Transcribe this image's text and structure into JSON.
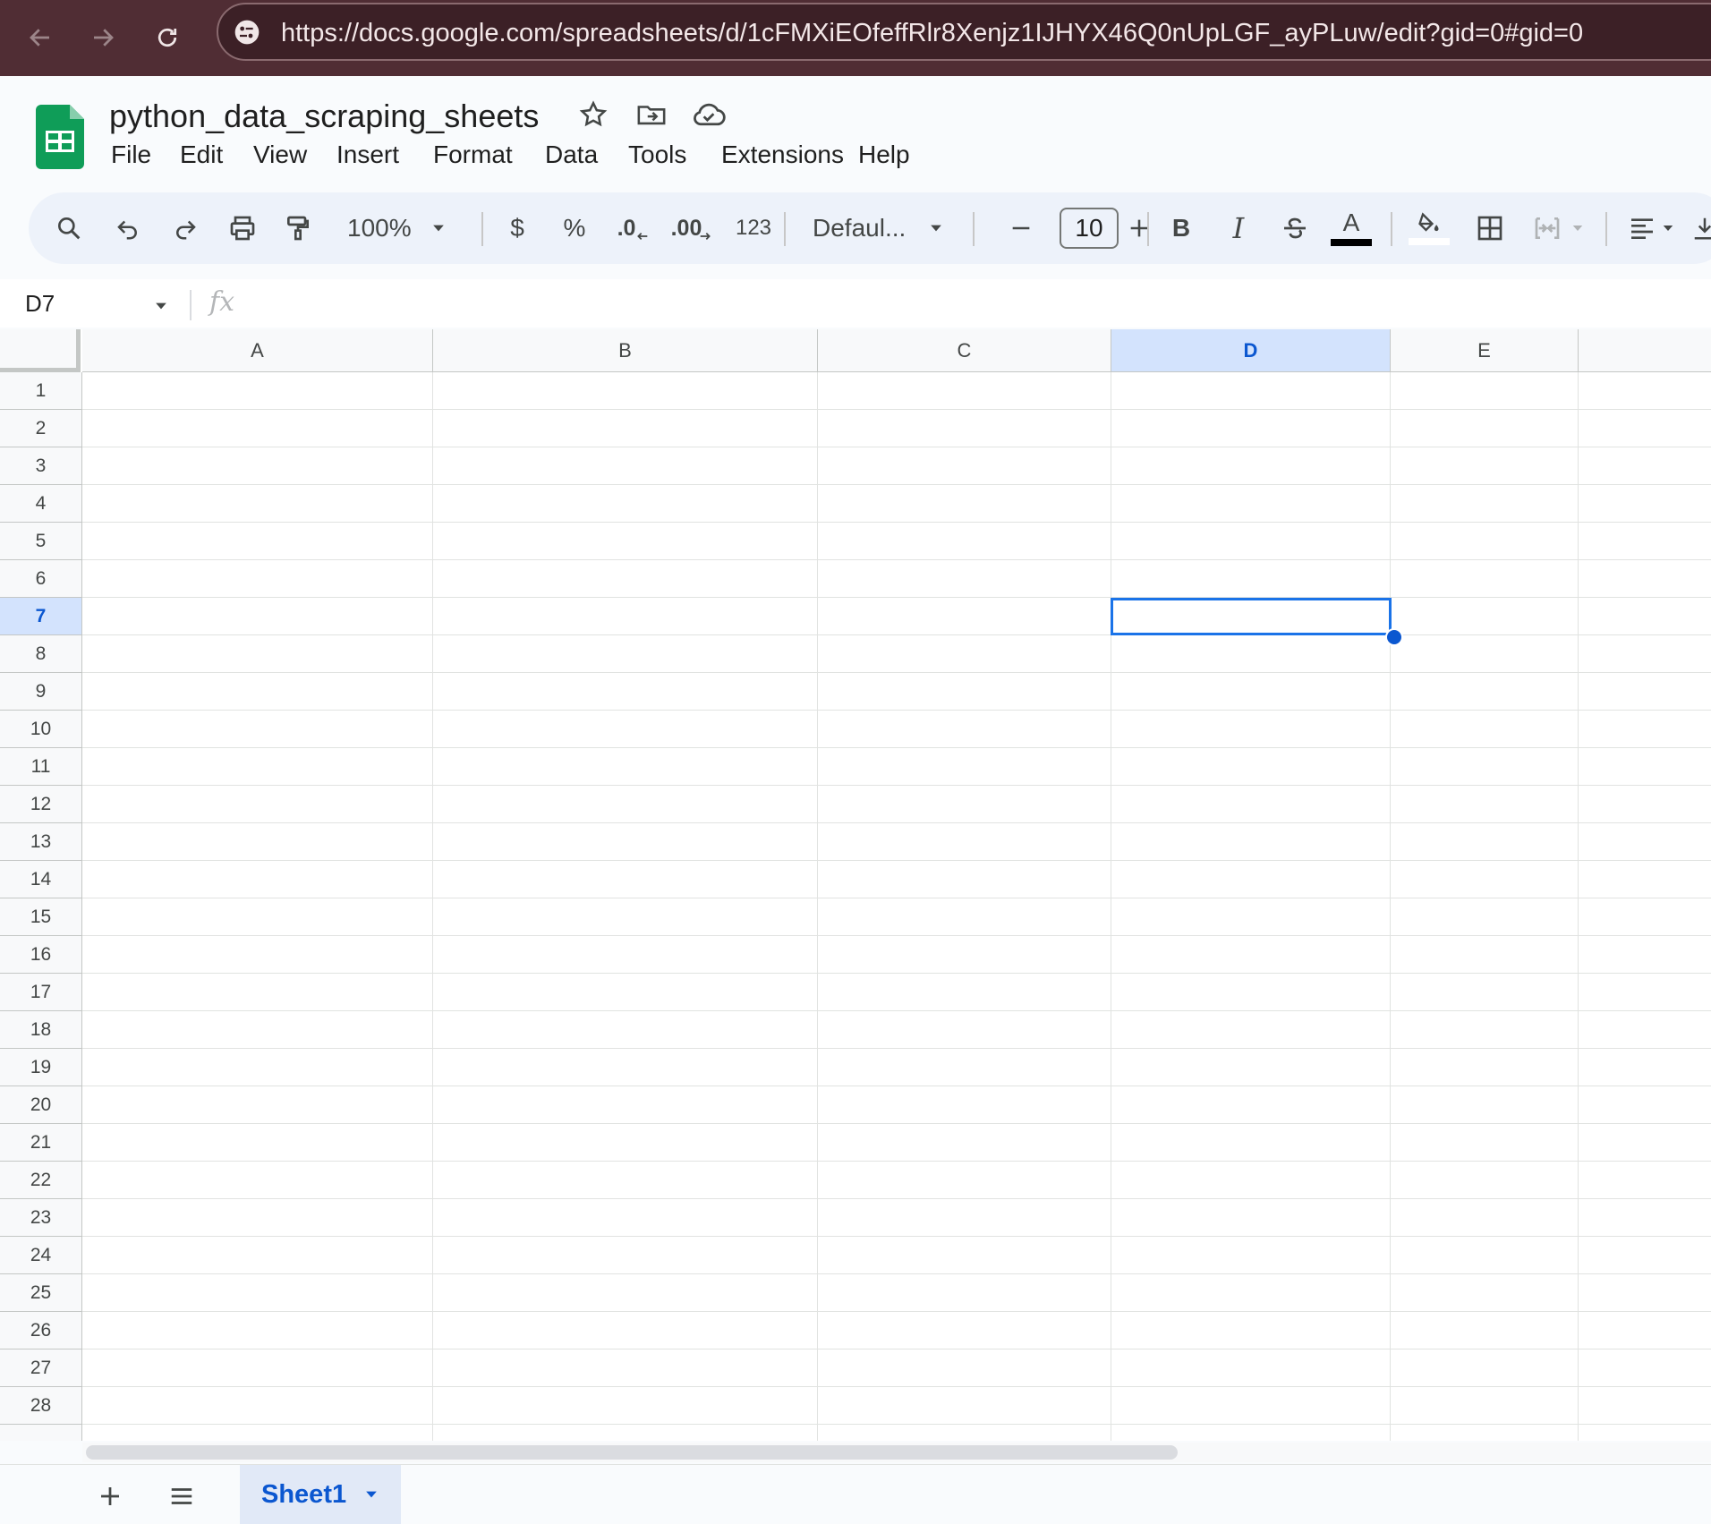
{
  "browser": {
    "url": "https://docs.google.com/spreadsheets/d/1cFMXiEOfeffRlr8Xenjz1IJHYX46Q0nUpLGF_ayPLuw/edit?gid=0#gid=0"
  },
  "app": {
    "title": "python_data_scraping_sheets",
    "menu": [
      "File",
      "Edit",
      "View",
      "Insert",
      "Format",
      "Data",
      "Tools",
      "Extensions",
      "Help"
    ]
  },
  "toolbar": {
    "zoom": "100%",
    "currency": "$",
    "percent": "%",
    "decrease_decimal": ".0",
    "increase_decimal": ".00",
    "number_format": "123",
    "font": "Defaul...",
    "font_size": "10",
    "bold": "B",
    "italic": "I",
    "text_color_letter": "A"
  },
  "formula_bar": {
    "name_box": "D7",
    "fx": "fx",
    "value": ""
  },
  "grid": {
    "columns": [
      "A",
      "B",
      "C",
      "D",
      "E"
    ],
    "rows": [
      "1",
      "2",
      "3",
      "4",
      "5",
      "6",
      "7",
      "8",
      "9",
      "10",
      "11",
      "12",
      "13",
      "14",
      "15",
      "16",
      "17",
      "18",
      "19",
      "20",
      "21",
      "22",
      "23",
      "24",
      "25",
      "26",
      "27",
      "28"
    ],
    "active_cell": "D7",
    "active_column": "D",
    "active_row": "7"
  },
  "sheets": {
    "tabs": [
      "Sheet1"
    ],
    "active": "Sheet1"
  },
  "colors": {
    "browser_bar": "#502d34",
    "accent": "#0b57d0",
    "selection_header": "#d3e3fd",
    "sheets_green": "#0f9d58"
  }
}
